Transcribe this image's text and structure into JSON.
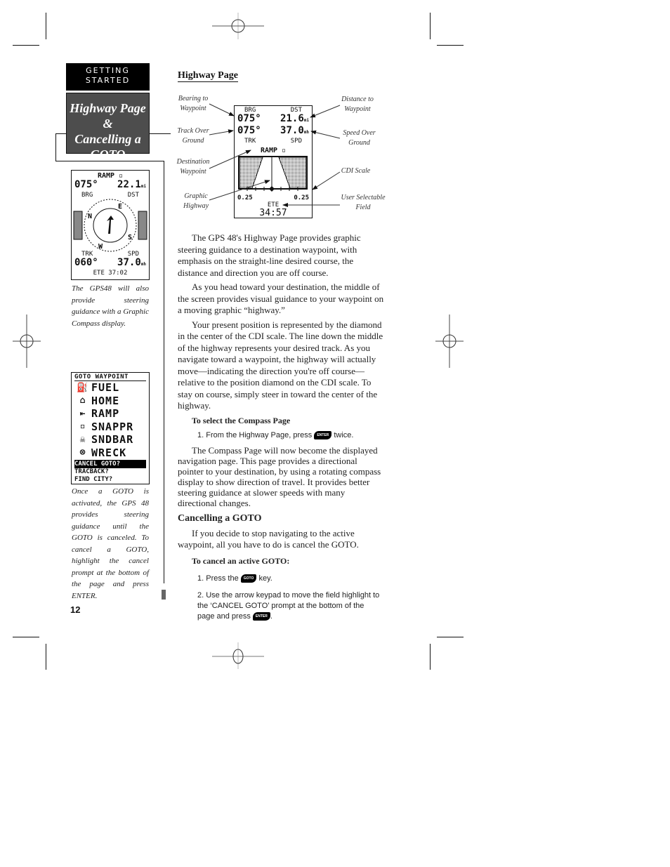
{
  "tab": {
    "section": "GETTING STARTED",
    "section_line1": "GETTING",
    "section_line2": "STARTED",
    "title_line1": "Highway Page &",
    "title_line2": "Cancelling a",
    "title_line3": "GOTO"
  },
  "compass_screen": {
    "waypoint": "RAMP ▫",
    "brg_value": "075°",
    "dst_value": "22.1",
    "dst_unit": "mi",
    "brg_label": "BRG",
    "dst_label": "DST",
    "dirs": {
      "n": "N",
      "e": "E",
      "s": "S",
      "w": "W"
    },
    "trk_label": "TRK",
    "spd_label": "SPD",
    "trk_value": "060°",
    "spd_value": "37.0",
    "spd_unit": "mh",
    "ete": "ETE  37:02",
    "caption": "The GPS48 will also provide steering guidance with a Graphic Compass display."
  },
  "goto_screen": {
    "title": "GOTO WAYPOINT",
    "items": [
      {
        "icon": "fuel-icon",
        "glyph": "⛽",
        "label": "FUEL"
      },
      {
        "icon": "home-icon",
        "glyph": "⌂",
        "label": "HOME"
      },
      {
        "icon": "ramp-icon",
        "glyph": "⇤",
        "label": "RAMP"
      },
      {
        "icon": "point-icon",
        "glyph": "▫",
        "label": "SNAPPR"
      },
      {
        "icon": "skull-icon",
        "glyph": "☠",
        "label": "SNDBAR"
      },
      {
        "icon": "wreck-icon",
        "glyph": "⊗",
        "label": "WRECK"
      }
    ],
    "options": [
      "CANCEL GOTO?",
      "TRACBACK?",
      "FIND CITY?"
    ],
    "caption": "Once a GOTO is activated, the GPS 48 provides steering guidance until the GOTO is canceled. To cancel a GOTO, highlight the cancel prompt at the bottom of the page and press ENTER."
  },
  "highway_figure": {
    "heading": "Highway Page",
    "screen": {
      "brg_label": "BRG",
      "dst_label": "DST",
      "brg_value": "075°",
      "dst_value": "21.6",
      "dst_unit": "mi",
      "trk_value": "075°",
      "spd_value": "37.0",
      "spd_unit": "mh",
      "trk_label": "TRK",
      "spd_label": "SPD",
      "waypoint": "RAMP ▫",
      "scale_left": "0.25",
      "scale_right": "0.25",
      "ete_label": "ETE",
      "ete_value": "34:57"
    },
    "callouts": {
      "bearing": "Bearing to Waypoint",
      "distance": "Distance to Waypoint",
      "track": "Track Over Ground",
      "speed": "Speed Over Ground",
      "destination": "Destination Waypoint",
      "cdi": "CDI Scale",
      "highway": "Graphic Highway",
      "user_field": "User Selectable Field"
    }
  },
  "body": {
    "p1": "The GPS 48's Highway Page provides graphic steering guidance to a destination waypoint, with emphasis on the straight-line desired course, the distance and direction you are off course.",
    "p2": "As you head toward your destination, the middle of the screen provides visual guidance to your waypoint on a moving graphic “highway.”",
    "p3": "Your present position is represented by the diamond in the center of the CDI scale.  The line down the middle of the highway represents your desired track.  As you navigate toward a waypoint, the highway will actually move—indicating the direction you're off course—relative to the position diamond on the CDI scale. To stay on course, simply steer in toward the center of the highway.",
    "compass_heading": "To select the Compass Page",
    "compass_step1_pre": "1. From the Highway Page, press",
    "compass_step1_post": "twice.",
    "p4": "The Compass Page will now become the displayed navigation page.  This page provides a directional pointer to your destination, by using a rotating compass display to show direction of travel.  It provides better steering guidance at slower speeds with many directional changes.",
    "cancel_heading": "Cancelling a GOTO",
    "p5": "If you decide to stop navigating to the active waypoint, all you have to do is cancel the GOTO.",
    "cancel_subheading": "To cancel an active GOTO:",
    "cancel_step1_pre": "1. Press the",
    "cancel_step1_post": "key.",
    "cancel_step2_pre": "2. Use the arrow keypad to move the field highlight to the ‘CANCEL GOTO’ prompt at the bottom of the page and press",
    "cancel_step2_post": "."
  },
  "keys": {
    "enter": "ENTER",
    "goto": "GOTO"
  },
  "page_number": "12"
}
